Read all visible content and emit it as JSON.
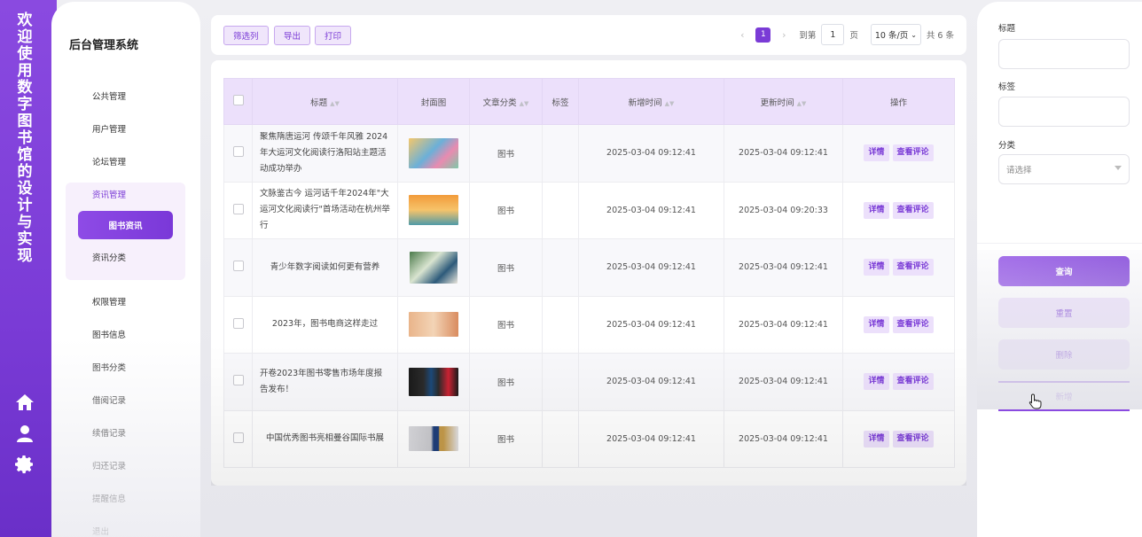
{
  "app": {
    "rail_title": "欢迎使用数字图书馆的设计与实现",
    "brand": "后台管理系统"
  },
  "rail_icons": [
    {
      "name": "home-icon"
    },
    {
      "name": "user-icon"
    },
    {
      "name": "gear-icon"
    }
  ],
  "sidebar": {
    "items": [
      {
        "label": "公共管理"
      },
      {
        "label": "用户管理"
      },
      {
        "label": "论坛管理"
      },
      {
        "label": "资讯管理",
        "expanded": true
      },
      {
        "label": "图书资讯",
        "active": true
      },
      {
        "label": "资讯分类"
      },
      {
        "label": "权限管理"
      },
      {
        "label": "图书信息"
      },
      {
        "label": "图书分类"
      },
      {
        "label": "借阅记录"
      },
      {
        "label": "续借记录"
      },
      {
        "label": "归还记录"
      },
      {
        "label": "提醒信息"
      },
      {
        "label": "退出"
      }
    ]
  },
  "toolbar": {
    "filter_label": "筛选列",
    "export_label": "导出",
    "print_label": "打印"
  },
  "pager": {
    "prev": "‹",
    "current_page": "1",
    "next": "›",
    "goto_prefix": "到第",
    "goto_value": "1",
    "goto_suffix": "页",
    "page_size": "10 条/页",
    "total": "共 6 条"
  },
  "table": {
    "columns": [
      "标题",
      "封面图",
      "文章分类",
      "标签",
      "新增时间",
      "更新时间",
      "操作"
    ],
    "detail_label": "详情",
    "comments_label": "查看评论",
    "rows": [
      {
        "title": "聚焦隋唐运河 传颂千年风雅 2024年大运河文化阅读行洛阳站主题活动成功举办",
        "category": "图书",
        "tag": "",
        "created": "2025-03-04 09:12:41",
        "updated": "2025-03-04 09:12:41"
      },
      {
        "title": "文脉鉴古今 运河话千年2024年\"大运河文化阅读行\"首场活动在杭州举行",
        "category": "图书",
        "tag": "",
        "created": "2025-03-04 09:12:41",
        "updated": "2025-03-04 09:20:33"
      },
      {
        "title": "青少年数字阅读如何更有营养",
        "category": "图书",
        "tag": "",
        "created": "2025-03-04 09:12:41",
        "updated": "2025-03-04 09:12:41"
      },
      {
        "title": "2023年，图书电商这样走过",
        "category": "图书",
        "tag": "",
        "created": "2025-03-04 09:12:41",
        "updated": "2025-03-04 09:12:41"
      },
      {
        "title": "开卷2023年图书零售市场年度报告发布！",
        "category": "图书",
        "tag": "",
        "created": "2025-03-04 09:12:41",
        "updated": "2025-03-04 09:12:41"
      },
      {
        "title": "中国优秀图书亮相曼谷国际书展",
        "category": "图书",
        "tag": "",
        "created": "2025-03-04 09:12:41",
        "updated": "2025-03-04 09:12:41"
      }
    ]
  },
  "search_panel": {
    "title_label": "标题",
    "title_value": "",
    "tag_label": "标签",
    "tag_value": "",
    "category_label": "分类",
    "category_placeholder": "请选择",
    "query_label": "查询",
    "reset_label": "重置",
    "delete_label": "删除",
    "add_label": "新增"
  }
}
